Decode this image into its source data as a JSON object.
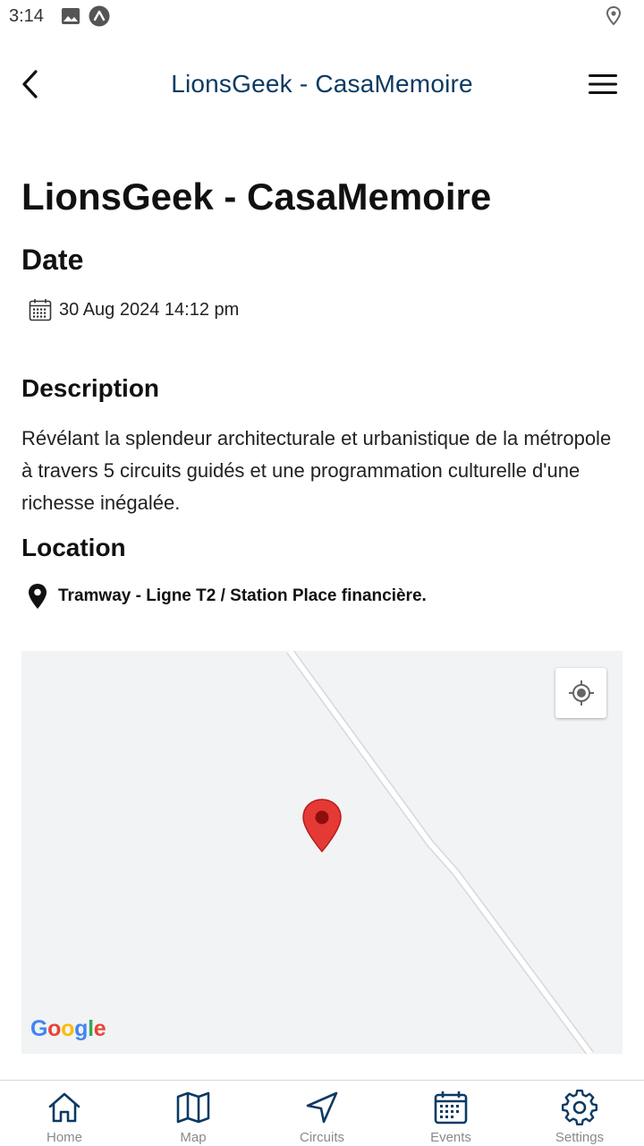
{
  "status_bar": {
    "time": "3:14",
    "icons": [
      "gallery-icon",
      "app-notification-icon",
      "location-icon"
    ]
  },
  "header": {
    "title": "LionsGeek - CasaMemoire",
    "back_icon": "chevron-left-icon",
    "menu_icon": "hamburger-menu-icon",
    "title_color": "#0b3a63"
  },
  "event": {
    "title": "LionsGeek - CasaMemoire",
    "date_heading": "Date",
    "date_value": "30 Aug 2024 14:12 pm",
    "description_heading": "Description",
    "description_text": "Révélant la splendeur architecturale et urbanistique de la métropole à travers 5 circuits guidés et une programmation culturelle d'une richesse inégalée.",
    "location_heading": "Location",
    "location_value": "Tramway - Ligne T2 / Station Place financière."
  },
  "map": {
    "logo_text": "Google",
    "marker_color": "#e53935",
    "background_color": "#f1f3f4"
  },
  "bottom_nav": {
    "items": [
      {
        "label": "Home",
        "icon": "home-icon"
      },
      {
        "label": "Map",
        "icon": "map-icon"
      },
      {
        "label": "Circuits",
        "icon": "navigation-arrow-icon"
      },
      {
        "label": "Events",
        "icon": "calendar-icon"
      },
      {
        "label": "Settings",
        "icon": "gear-icon"
      }
    ],
    "icon_color": "#0b3a63",
    "label_color": "#8a8a8a"
  }
}
